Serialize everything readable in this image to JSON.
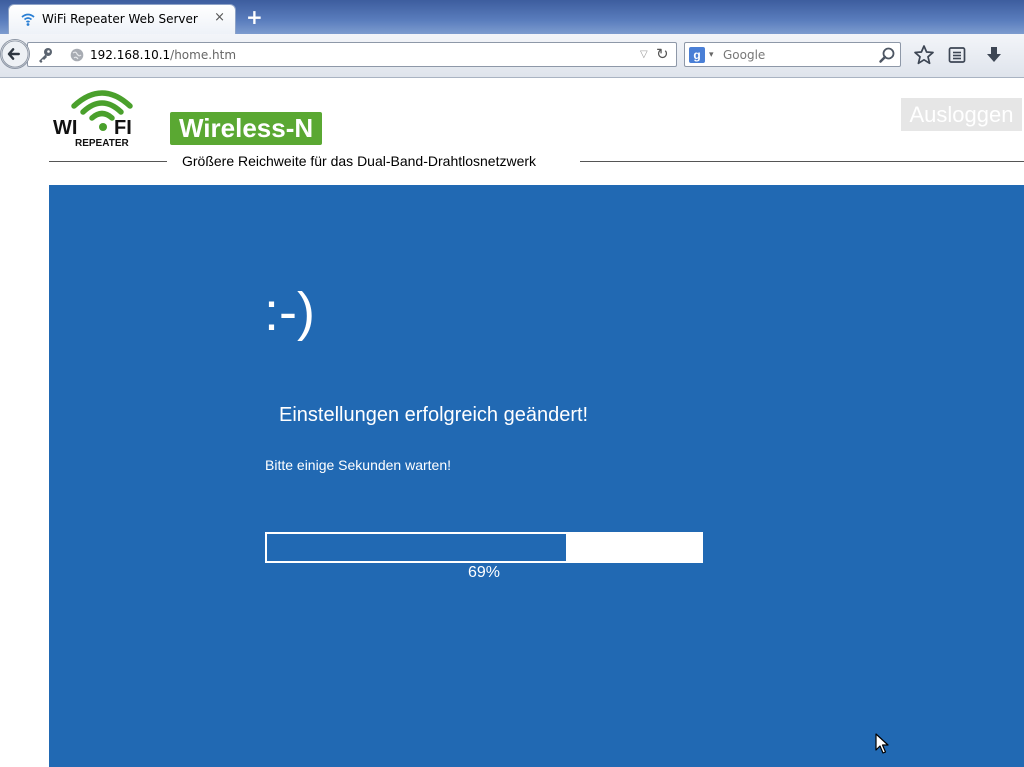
{
  "browser": {
    "tab_title": "WiFi Repeater Web Server",
    "tab_close": "×",
    "new_tab": "+",
    "url_host": "192.168.10.1",
    "url_path": "/home.htm",
    "search_placeholder": "Google",
    "search_engine_letter": "g"
  },
  "header": {
    "logo_text_wi": "WI",
    "logo_text_fi": "FI",
    "logo_subtext": "REPEATER",
    "badge": "Wireless-N",
    "logout_label": "Ausloggen",
    "tagline": "Größere Reichweite für das Dual-Band-Drahtlosnetzwerk"
  },
  "status": {
    "smiley": ":-)",
    "message": "Einstellungen erfolgreich geändert!",
    "wait_text": "Bitte einige Sekunden warten!",
    "progress": 0.69,
    "progress_label": "69%"
  },
  "colors": {
    "panel": "#2169b3",
    "badge_green": "#5aa832",
    "logo_green": "#4aa02c"
  }
}
